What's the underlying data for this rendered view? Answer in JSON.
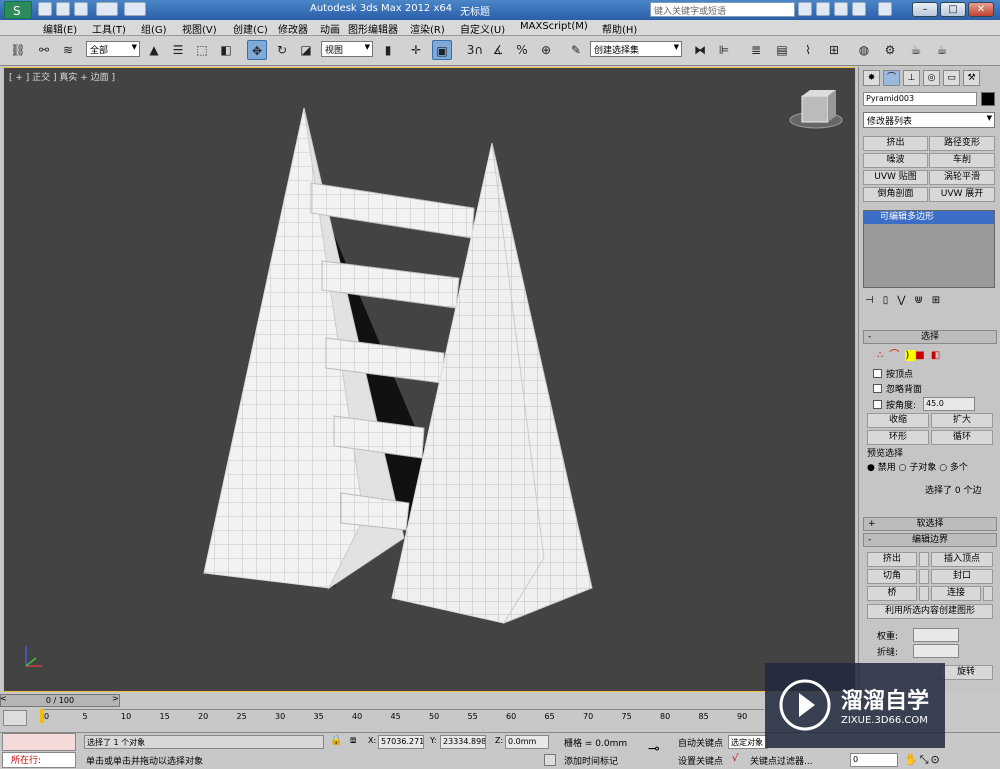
{
  "window": {
    "title_app": "Autodesk 3ds Max  2012 x64",
    "title_doc": "无标题",
    "search_placeholder": "键入关键字或短语"
  },
  "menu": [
    "编辑(E)",
    "工具(T)",
    "组(G)",
    "视图(V)",
    "创建(C)",
    "修改器",
    "动画",
    "图形编辑器",
    "渲染(R)",
    "自定义(U)",
    "MAXScript(M)",
    "帮助(H)"
  ],
  "toolbar": {
    "selection_filter": "全部",
    "ref_coord": "视图",
    "named_selection": "创建选择集",
    "angle_snap_label": "3"
  },
  "viewport": {
    "label": "[ + ] 正交 ] 真实 + 边面 ]",
    "background": "#434343",
    "mesh_color": "#f2f2f2"
  },
  "command_panel": {
    "object_name": "Pyramid003",
    "modifier_list": "修改器列表",
    "modifier_buttons": [
      "挤出",
      "路径变形",
      "噪波",
      "车削",
      "UVW 贴图",
      "涡轮平滑",
      "倒角剖面",
      "UVW 展开"
    ],
    "stack_item": "可编辑多边形",
    "selection_rollout": {
      "title": "选择",
      "by_vertex": "按顶点",
      "ignore_backface": "忽略背面",
      "by_angle": "按角度:",
      "angle_value": "45.0",
      "shrink": "收缩",
      "grow": "扩大",
      "ring": "环形",
      "loop": "循环",
      "preview_title": "预览选择",
      "preview_disable": "禁用",
      "preview_subobj": "子对象",
      "preview_multi": "多个",
      "selected_info": "选择了 0 个边"
    },
    "soft_selection": "软选择",
    "edit_borders": {
      "title": "编辑边界",
      "extrude": "挤出",
      "insert_vertex": "插入顶点",
      "chamfer": "切角",
      "cap": "封口",
      "bridge": "桥",
      "connect": "连接",
      "create_shape": "利用所选内容创建图形",
      "weight": "权重:",
      "crease": "折缝:",
      "rotate": "旋转"
    }
  },
  "timeline": {
    "frame": "0 / 100",
    "ticks": [
      "0",
      "5",
      "10",
      "15",
      "20",
      "25",
      "30",
      "35",
      "40",
      "45",
      "50",
      "55",
      "60",
      "65",
      "70",
      "75",
      "80",
      "85",
      "90"
    ]
  },
  "status": {
    "current_label": "所在行:",
    "selection_msg": "选择了 1 个对象",
    "prompt_msg": "单击或单击并拖动以选择对象",
    "x_label": "X:",
    "x_value": "57036.271",
    "y_label": "Y:",
    "y_value": "23334.898",
    "z_label": "Z:",
    "z_value": "0.0mm",
    "grid": "栅格 = 0.0mm",
    "add_time_tag": "添加时间标记",
    "auto_key": "自动关键点",
    "auto_key_mode": "选定对象",
    "set_key": "设置关键点",
    "key_filters": "关键点过滤器...",
    "frame_value": "0"
  },
  "watermark": {
    "title": "溜溜自学",
    "url": "ZIXUE.3D66.COM"
  }
}
